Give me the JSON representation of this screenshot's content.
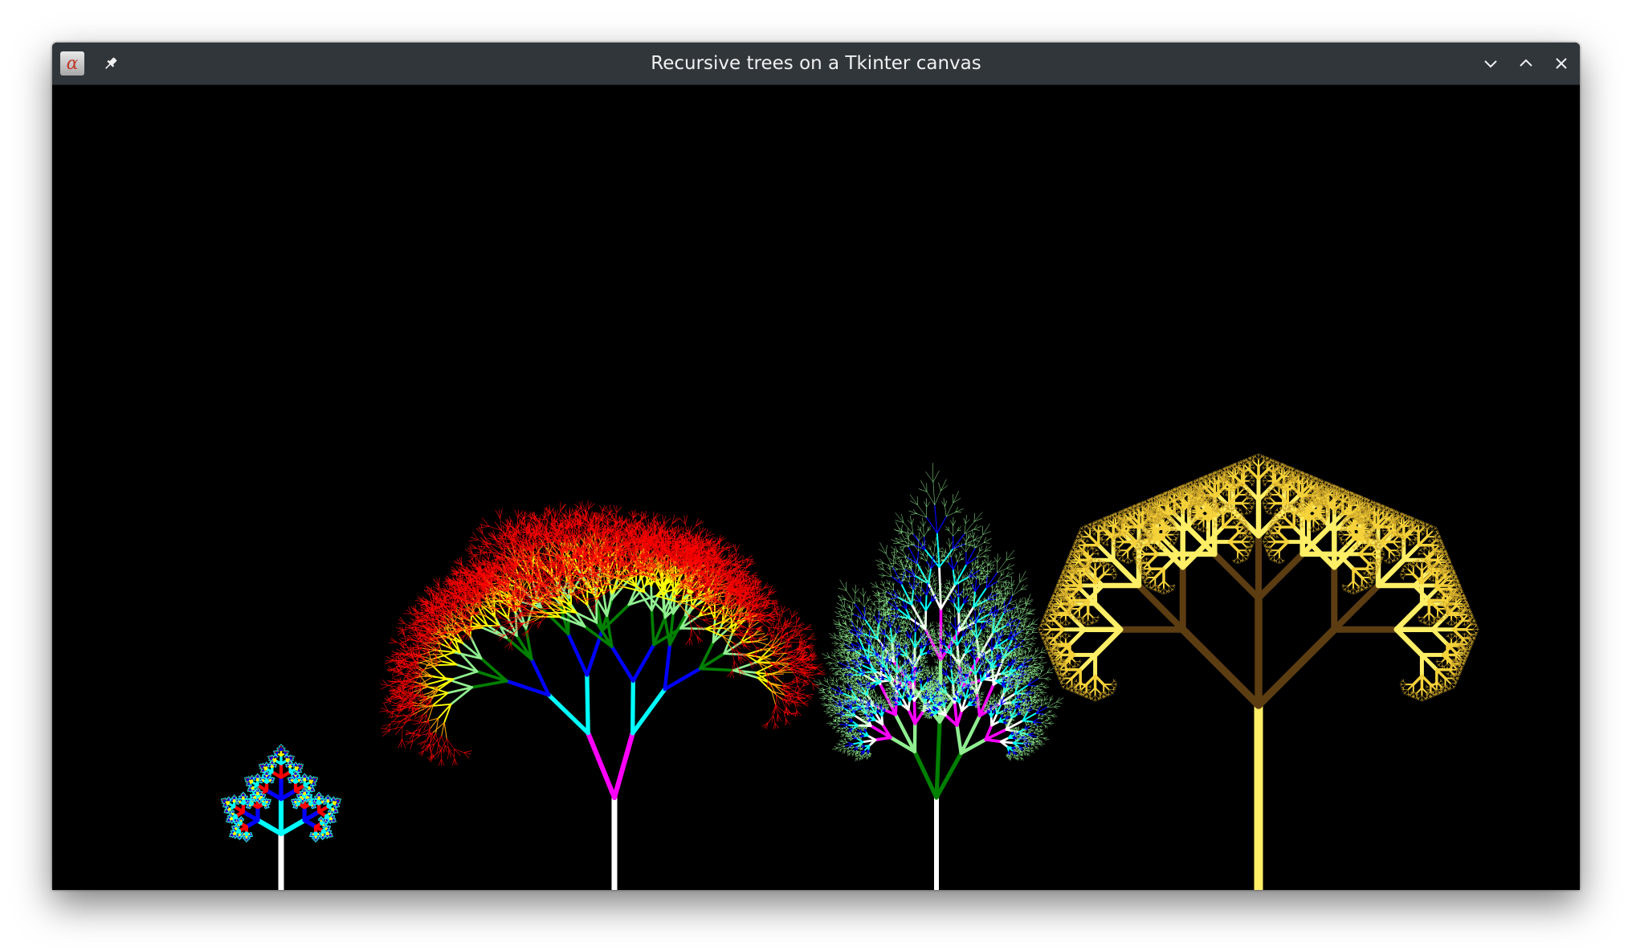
{
  "window": {
    "title": "Recursive trees on a Tkinter canvas",
    "icon": "tk-app-icon",
    "controls": [
      {
        "name": "minimize",
        "icon": "chevron-down-icon"
      },
      {
        "name": "maximize",
        "icon": "chevron-up-icon"
      },
      {
        "name": "close",
        "icon": "close-icon"
      }
    ],
    "pin_icon": "pin-icon"
  },
  "canvas": {
    "background": "#000000",
    "trees": [
      {
        "name": "crystal-tree",
        "palette": [
          "#ffffff",
          "#00ffff",
          "#0000ff",
          "#ff0000",
          "#ffa500",
          "#ffff00"
        ]
      },
      {
        "name": "rainbow-tree",
        "palette": [
          "#ffffff",
          "#ff00ff",
          "#00ffff",
          "#0000ff",
          "#008000",
          "#90ee90",
          "#ffff00",
          "#ffa500",
          "#ff0000"
        ]
      },
      {
        "name": "spruce-tree",
        "palette": [
          "#ffffff",
          "#008000",
          "#90ee90",
          "#ff00ff",
          "#00ffff",
          "#0000ff",
          "#98fb98"
        ]
      },
      {
        "name": "golden-tree",
        "palette": [
          "#ffee66",
          "#5c3d12",
          "#f5d23a",
          "#c9a227"
        ]
      }
    ]
  }
}
